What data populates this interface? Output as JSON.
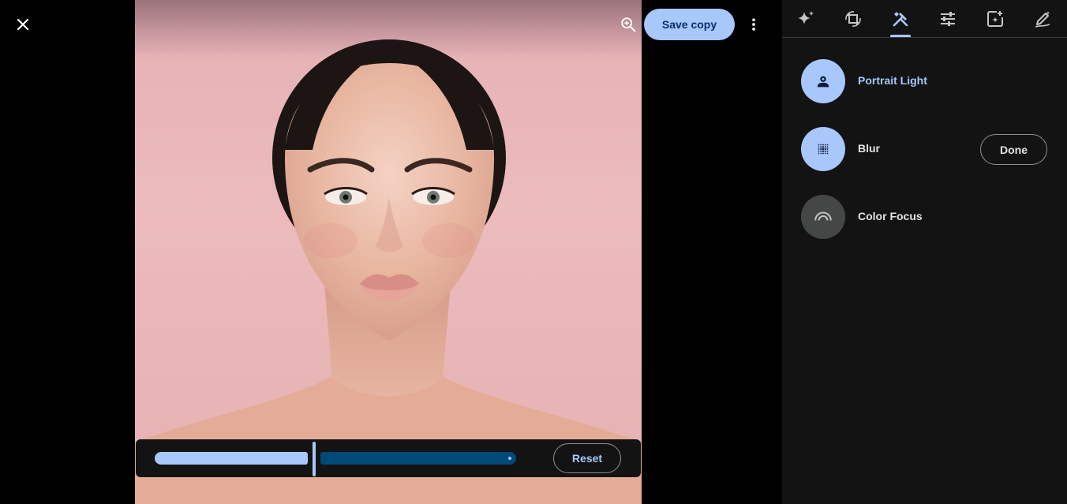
{
  "toolbar": {
    "close_icon": "close-icon",
    "zoom_icon": "zoom-in-icon",
    "save_label": "Save copy",
    "more_icon": "more-vert-icon"
  },
  "editor": {
    "slider": {
      "value_fraction": 0.44,
      "reset_label": "Reset"
    }
  },
  "panel": {
    "tabs": [
      {
        "name": "suggestions",
        "icon": "sparkle-icon"
      },
      {
        "name": "crop",
        "icon": "crop-rotate-icon"
      },
      {
        "name": "tools",
        "icon": "tools-icon",
        "active": true
      },
      {
        "name": "adjust",
        "icon": "tune-icon"
      },
      {
        "name": "filters",
        "icon": "filter-add-icon"
      },
      {
        "name": "markup",
        "icon": "markup-pen-icon"
      }
    ],
    "tools": [
      {
        "label": "Portrait Light",
        "icon": "portrait-light-icon",
        "active": true
      },
      {
        "label": "Blur",
        "icon": "blur-icon",
        "active": false
      },
      {
        "label": "Color Focus",
        "icon": "color-focus-icon",
        "active": false
      }
    ],
    "done_label": "Done"
  },
  "colors": {
    "accent": "#a8c7fa",
    "accent_dark": "#004a77",
    "panel_bg": "#131314",
    "photo_bg": "#ecbbbd"
  }
}
